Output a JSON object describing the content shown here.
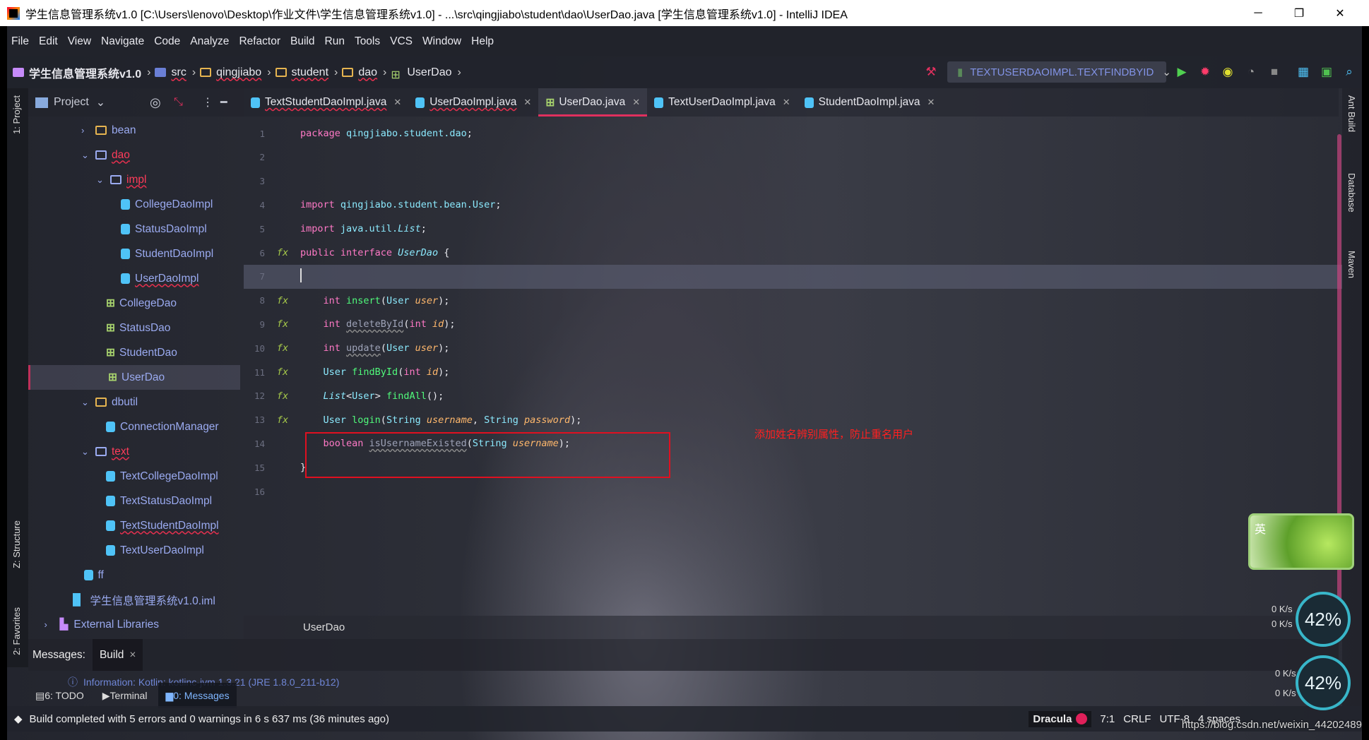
{
  "window": {
    "title": "学生信息管理系统v1.0 [C:\\Users\\lenovo\\Desktop\\作业文件\\学生信息管理系统v1.0] - ...\\src\\qingjiabo\\student\\dao\\UserDao.java [学生信息管理系统v1.0] - IntelliJ IDEA",
    "minimize": "─",
    "restore": "❐",
    "close": "✕"
  },
  "menu": [
    "File",
    "Edit",
    "View",
    "Navigate",
    "Code",
    "Analyze",
    "Refactor",
    "Build",
    "Run",
    "Tools",
    "VCS",
    "Window",
    "Help"
  ],
  "breadcrumb": [
    "学生信息管理系统v1.0",
    "src",
    "qingjiabo",
    "student",
    "dao",
    "UserDao"
  ],
  "toolbar": {
    "run_config": "TEXTUSERDAOIMPL.TEXTFINDBYID",
    "icons": [
      "hammer-icon",
      "run-icon",
      "debug-icon",
      "coverage-icon",
      "profiler-icon",
      "stop-icon",
      "structure-icon",
      "terminal-icon",
      "search-icon"
    ]
  },
  "project": {
    "title": "Project",
    "tree": [
      {
        "label": "bean",
        "level": 0,
        "type": "package",
        "arrow": "›"
      },
      {
        "label": "dao",
        "level": 0,
        "type": "folder",
        "arrow": "⌄",
        "error": true
      },
      {
        "label": "impl",
        "level": 1,
        "type": "folder",
        "arrow": "⌄",
        "error": true
      },
      {
        "label": "CollegeDaoImpl",
        "level": 2,
        "type": "class"
      },
      {
        "label": "StatusDaoImpl",
        "level": 2,
        "type": "class"
      },
      {
        "label": "StudentDaoImpl",
        "level": 2,
        "type": "class"
      },
      {
        "label": "UserDaoImpl",
        "level": 2,
        "type": "class",
        "squiggle": true
      },
      {
        "label": "CollegeDao",
        "level": 1,
        "type": "interface"
      },
      {
        "label": "StatusDao",
        "level": 1,
        "type": "interface"
      },
      {
        "label": "StudentDao",
        "level": 1,
        "type": "interface"
      },
      {
        "label": "UserDao",
        "level": 1,
        "type": "interface",
        "selected": true
      },
      {
        "label": "dbutil",
        "level": 0,
        "type": "package",
        "arrow": "⌄"
      },
      {
        "label": "ConnectionManager",
        "level": 1,
        "type": "class"
      },
      {
        "label": "text",
        "level": 0,
        "type": "folder",
        "arrow": "⌄",
        "error": true
      },
      {
        "label": "TextCollegeDaoImpl",
        "level": 1,
        "type": "class"
      },
      {
        "label": "TextStatusDaoImpl",
        "level": 1,
        "type": "class"
      },
      {
        "label": "TextStudentDaoImpl",
        "level": 1,
        "type": "class",
        "squiggle": true
      },
      {
        "label": "TextUserDaoImpl",
        "level": 1,
        "type": "class"
      },
      {
        "label": "ff",
        "level": -0.5,
        "type": "class"
      },
      {
        "label": "学生信息管理系统v1.0.iml",
        "level": -1.5,
        "type": "iml"
      },
      {
        "label": "External Libraries",
        "level": -2.5,
        "type": "lib",
        "arrow": "›"
      }
    ]
  },
  "left_strip": {
    "project": "1: Project",
    "structure": "Z: Structure",
    "favorites": "2: Favorites"
  },
  "right_strip": {
    "ant": "Ant Build",
    "database": "Database",
    "maven": "Maven"
  },
  "tabs": [
    {
      "label": "TextStudentDaoImpl.java",
      "type": "class",
      "squiggle": true
    },
    {
      "label": "UserDaoImpl.java",
      "type": "class",
      "squiggle": true
    },
    {
      "label": "UserDao.java",
      "type": "interface",
      "active": true
    },
    {
      "label": "TextUserDaoImpl.java",
      "type": "class"
    },
    {
      "label": "StudentDaoImpl.java",
      "type": "class"
    }
  ],
  "editor": {
    "current_line": 7,
    "lines": [
      {
        "n": "1",
        "tokens": [
          [
            "package ",
            "kw"
          ],
          [
            "qingjiabo.student.dao",
            "pk"
          ],
          [
            ";",
            "pl"
          ]
        ]
      },
      {
        "n": "2",
        "tokens": []
      },
      {
        "n": "3",
        "tokens": []
      },
      {
        "n": "4",
        "tokens": [
          [
            "import ",
            "kw"
          ],
          [
            "qingjiabo.student.bean.User",
            "pk"
          ],
          [
            ";",
            "pl"
          ]
        ]
      },
      {
        "n": "5",
        "tokens": [
          [
            "import ",
            "kw"
          ],
          [
            "java.util.",
            "pk"
          ],
          [
            "List",
            "tyi"
          ],
          [
            ";",
            "pl"
          ]
        ]
      },
      {
        "n": "6",
        "gutter": true,
        "tokens": [
          [
            "public interface ",
            "kw"
          ],
          [
            "UserDao",
            "tyi"
          ],
          [
            " {",
            "pl"
          ]
        ]
      },
      {
        "n": "7",
        "tokens": []
      },
      {
        "n": "8",
        "gutter": true,
        "tokens": [
          [
            "    int ",
            "kw"
          ],
          [
            "insert",
            "fn"
          ],
          [
            "(",
            "pl"
          ],
          [
            "User ",
            "ty"
          ],
          [
            "user",
            "pa"
          ],
          [
            ");",
            "pl"
          ]
        ]
      },
      {
        "n": "9",
        "gutter": true,
        "tokens": [
          [
            "    int ",
            "kw"
          ],
          [
            "deleteById",
            "un"
          ],
          [
            "(",
            "pl"
          ],
          [
            "int ",
            "kw"
          ],
          [
            "id",
            "pa"
          ],
          [
            ");",
            "pl"
          ]
        ]
      },
      {
        "n": "10",
        "gutter": true,
        "tokens": [
          [
            "    int ",
            "kw"
          ],
          [
            "update",
            "un"
          ],
          [
            "(",
            "pl"
          ],
          [
            "User ",
            "ty"
          ],
          [
            "user",
            "pa"
          ],
          [
            ");",
            "pl"
          ]
        ]
      },
      {
        "n": "11",
        "gutter": true,
        "tokens": [
          [
            "    User ",
            "ty"
          ],
          [
            "findById",
            "fn"
          ],
          [
            "(",
            "pl"
          ],
          [
            "int ",
            "kw"
          ],
          [
            "id",
            "pa"
          ],
          [
            ");",
            "pl"
          ]
        ]
      },
      {
        "n": "12",
        "gutter": true,
        "tokens": [
          [
            "    List",
            "tyi"
          ],
          [
            "<",
            "pl"
          ],
          [
            "User",
            "ty"
          ],
          [
            "> ",
            "pl"
          ],
          [
            "findAll",
            "fn"
          ],
          [
            "();",
            "pl"
          ]
        ]
      },
      {
        "n": "13",
        "gutter": true,
        "tokens": [
          [
            "    User ",
            "ty"
          ],
          [
            "login",
            "fn"
          ],
          [
            "(",
            "pl"
          ],
          [
            "String ",
            "ty"
          ],
          [
            "username",
            "pa"
          ],
          [
            ", ",
            "pl"
          ],
          [
            "String ",
            "ty"
          ],
          [
            "password",
            "pa"
          ],
          [
            ");",
            "pl"
          ]
        ]
      },
      {
        "n": "14",
        "tokens": [
          [
            "    boolean ",
            "kw"
          ],
          [
            "isUsernameExisted",
            "un"
          ],
          [
            "(",
            "pl"
          ],
          [
            "String ",
            "ty"
          ],
          [
            "username",
            "pa"
          ],
          [
            ");",
            "pl"
          ]
        ]
      },
      {
        "n": "15",
        "tokens": [
          [
            "}",
            "pl"
          ]
        ]
      },
      {
        "n": "16",
        "tokens": []
      }
    ],
    "gutter_icon": "fx",
    "annotation": "添加姓名辨别属性，防止重名用户",
    "breadcrumb": "UserDao"
  },
  "messages": {
    "label": "Messages:",
    "tab": "Build",
    "close": "×",
    "info": "Information: Kotlin: kotlinc-jvm 1.3.21 (JRE 1.8.0_211-b12)"
  },
  "bottom_tabs": [
    "6: TODO",
    "Terminal",
    "0: Messages"
  ],
  "status": {
    "text": "Build completed with 5 errors and 0 warnings in 6 s 637 ms (36 minutes ago)",
    "theme": "Dracula",
    "position": "7:1",
    "line_sep": "CRLF",
    "encoding": "UTF-8",
    "indent": "4 spaces"
  },
  "widgets": {
    "ime": "英",
    "up": "0 K/s",
    "down": "0 K/s",
    "percent": "42%",
    "up2": "0 K/s",
    "down2": "0 K/s",
    "percent2": "42%"
  },
  "watermark": "https://blog.csdn.net/weixin_44202489",
  "colors": {
    "accent": "#e0305e",
    "keyword": "#ff79c6",
    "function": "#50fa7b",
    "param": "#ffb86c",
    "type": "#8be9fd",
    "annotation_box": "#e01020"
  }
}
